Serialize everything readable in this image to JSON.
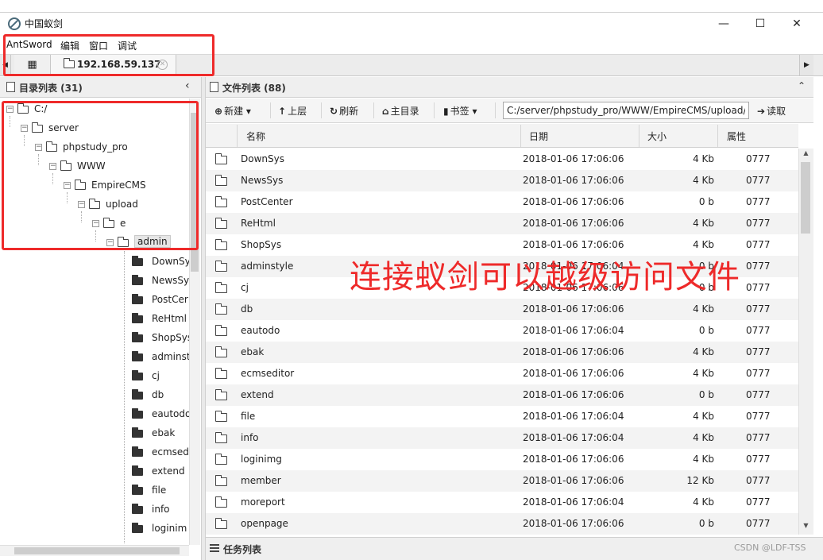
{
  "window": {
    "title": "中国蚁剑",
    "controls": {
      "minimize": "—",
      "maximize": "☐",
      "close": "✕"
    }
  },
  "menubar": [
    "AntSword",
    "编辑",
    "窗口",
    "调试"
  ],
  "tabs": {
    "home_icon": "grid-icon",
    "active_label": "192.168.59.137",
    "close_glyph": "✕"
  },
  "dir_panel": {
    "title": "目录列表 (31)",
    "collapse_glyph": "‹",
    "tree": [
      {
        "label": "C:/",
        "depth": 0
      },
      {
        "label": "server",
        "depth": 1
      },
      {
        "label": "phpstudy_pro",
        "depth": 2
      },
      {
        "label": "WWW",
        "depth": 3
      },
      {
        "label": "EmpireCMS",
        "depth": 4
      },
      {
        "label": "upload",
        "depth": 5
      },
      {
        "label": "e",
        "depth": 6
      },
      {
        "label": "admin",
        "depth": 7,
        "selected": true
      }
    ],
    "children": [
      "DownSy",
      "NewsSy",
      "PostCer",
      "ReHtml",
      "ShopSys",
      "adminst",
      "cj",
      "db",
      "eautodo",
      "ebak",
      "ecmsed",
      "extend",
      "file",
      "info",
      "loginim"
    ]
  },
  "file_panel": {
    "title": "文件列表 (88)",
    "collapse_glyph": "⌃",
    "toolbar": {
      "new_label": "新建",
      "up_label": "上层",
      "refresh_label": "刷新",
      "home_label": "主目录",
      "bookmark_label": "书签",
      "read_label": "读取",
      "path_value": "C:/server/phpstudy_pro/WWW/EmpireCMS/upload/e/admin/"
    },
    "columns": [
      "名称",
      "日期",
      "大小",
      "属性"
    ],
    "rows": [
      {
        "name": "DownSys",
        "date": "2018-01-06 17:06:06",
        "size": "4 Kb",
        "attr": "0777"
      },
      {
        "name": "NewsSys",
        "date": "2018-01-06 17:06:06",
        "size": "4 Kb",
        "attr": "0777"
      },
      {
        "name": "PostCenter",
        "date": "2018-01-06 17:06:06",
        "size": "0 b",
        "attr": "0777"
      },
      {
        "name": "ReHtml",
        "date": "2018-01-06 17:06:06",
        "size": "4 Kb",
        "attr": "0777"
      },
      {
        "name": "ShopSys",
        "date": "2018-01-06 17:06:06",
        "size": "4 Kb",
        "attr": "0777"
      },
      {
        "name": "adminstyle",
        "date": "2018-01-06 17:06:04",
        "size": "0 b",
        "attr": "0777"
      },
      {
        "name": "cj",
        "date": "2018-01-06 17:06:06",
        "size": "0 b",
        "attr": "0777"
      },
      {
        "name": "db",
        "date": "2018-01-06 17:06:06",
        "size": "4 Kb",
        "attr": "0777"
      },
      {
        "name": "eautodo",
        "date": "2018-01-06 17:06:04",
        "size": "0 b",
        "attr": "0777"
      },
      {
        "name": "ebak",
        "date": "2018-01-06 17:06:06",
        "size": "4 Kb",
        "attr": "0777"
      },
      {
        "name": "ecmseditor",
        "date": "2018-01-06 17:06:06",
        "size": "4 Kb",
        "attr": "0777"
      },
      {
        "name": "extend",
        "date": "2018-01-06 17:06:06",
        "size": "0 b",
        "attr": "0777"
      },
      {
        "name": "file",
        "date": "2018-01-06 17:06:04",
        "size": "4 Kb",
        "attr": "0777"
      },
      {
        "name": "info",
        "date": "2018-01-06 17:06:04",
        "size": "4 Kb",
        "attr": "0777"
      },
      {
        "name": "loginimg",
        "date": "2018-01-06 17:06:06",
        "size": "4 Kb",
        "attr": "0777"
      },
      {
        "name": "member",
        "date": "2018-01-06 17:06:06",
        "size": "12 Kb",
        "attr": "0777"
      },
      {
        "name": "moreport",
        "date": "2018-01-06 17:06:04",
        "size": "4 Kb",
        "attr": "0777"
      },
      {
        "name": "openpage",
        "date": "2018-01-06 17:06:06",
        "size": "0 b",
        "attr": "0777"
      }
    ]
  },
  "task_panel": {
    "title": "任务列表"
  },
  "annotation": {
    "text": "连接蚁剑可以越级访问文件",
    "color": "#ee2a2a"
  },
  "watermark": "CSDN @LDF-TSS"
}
